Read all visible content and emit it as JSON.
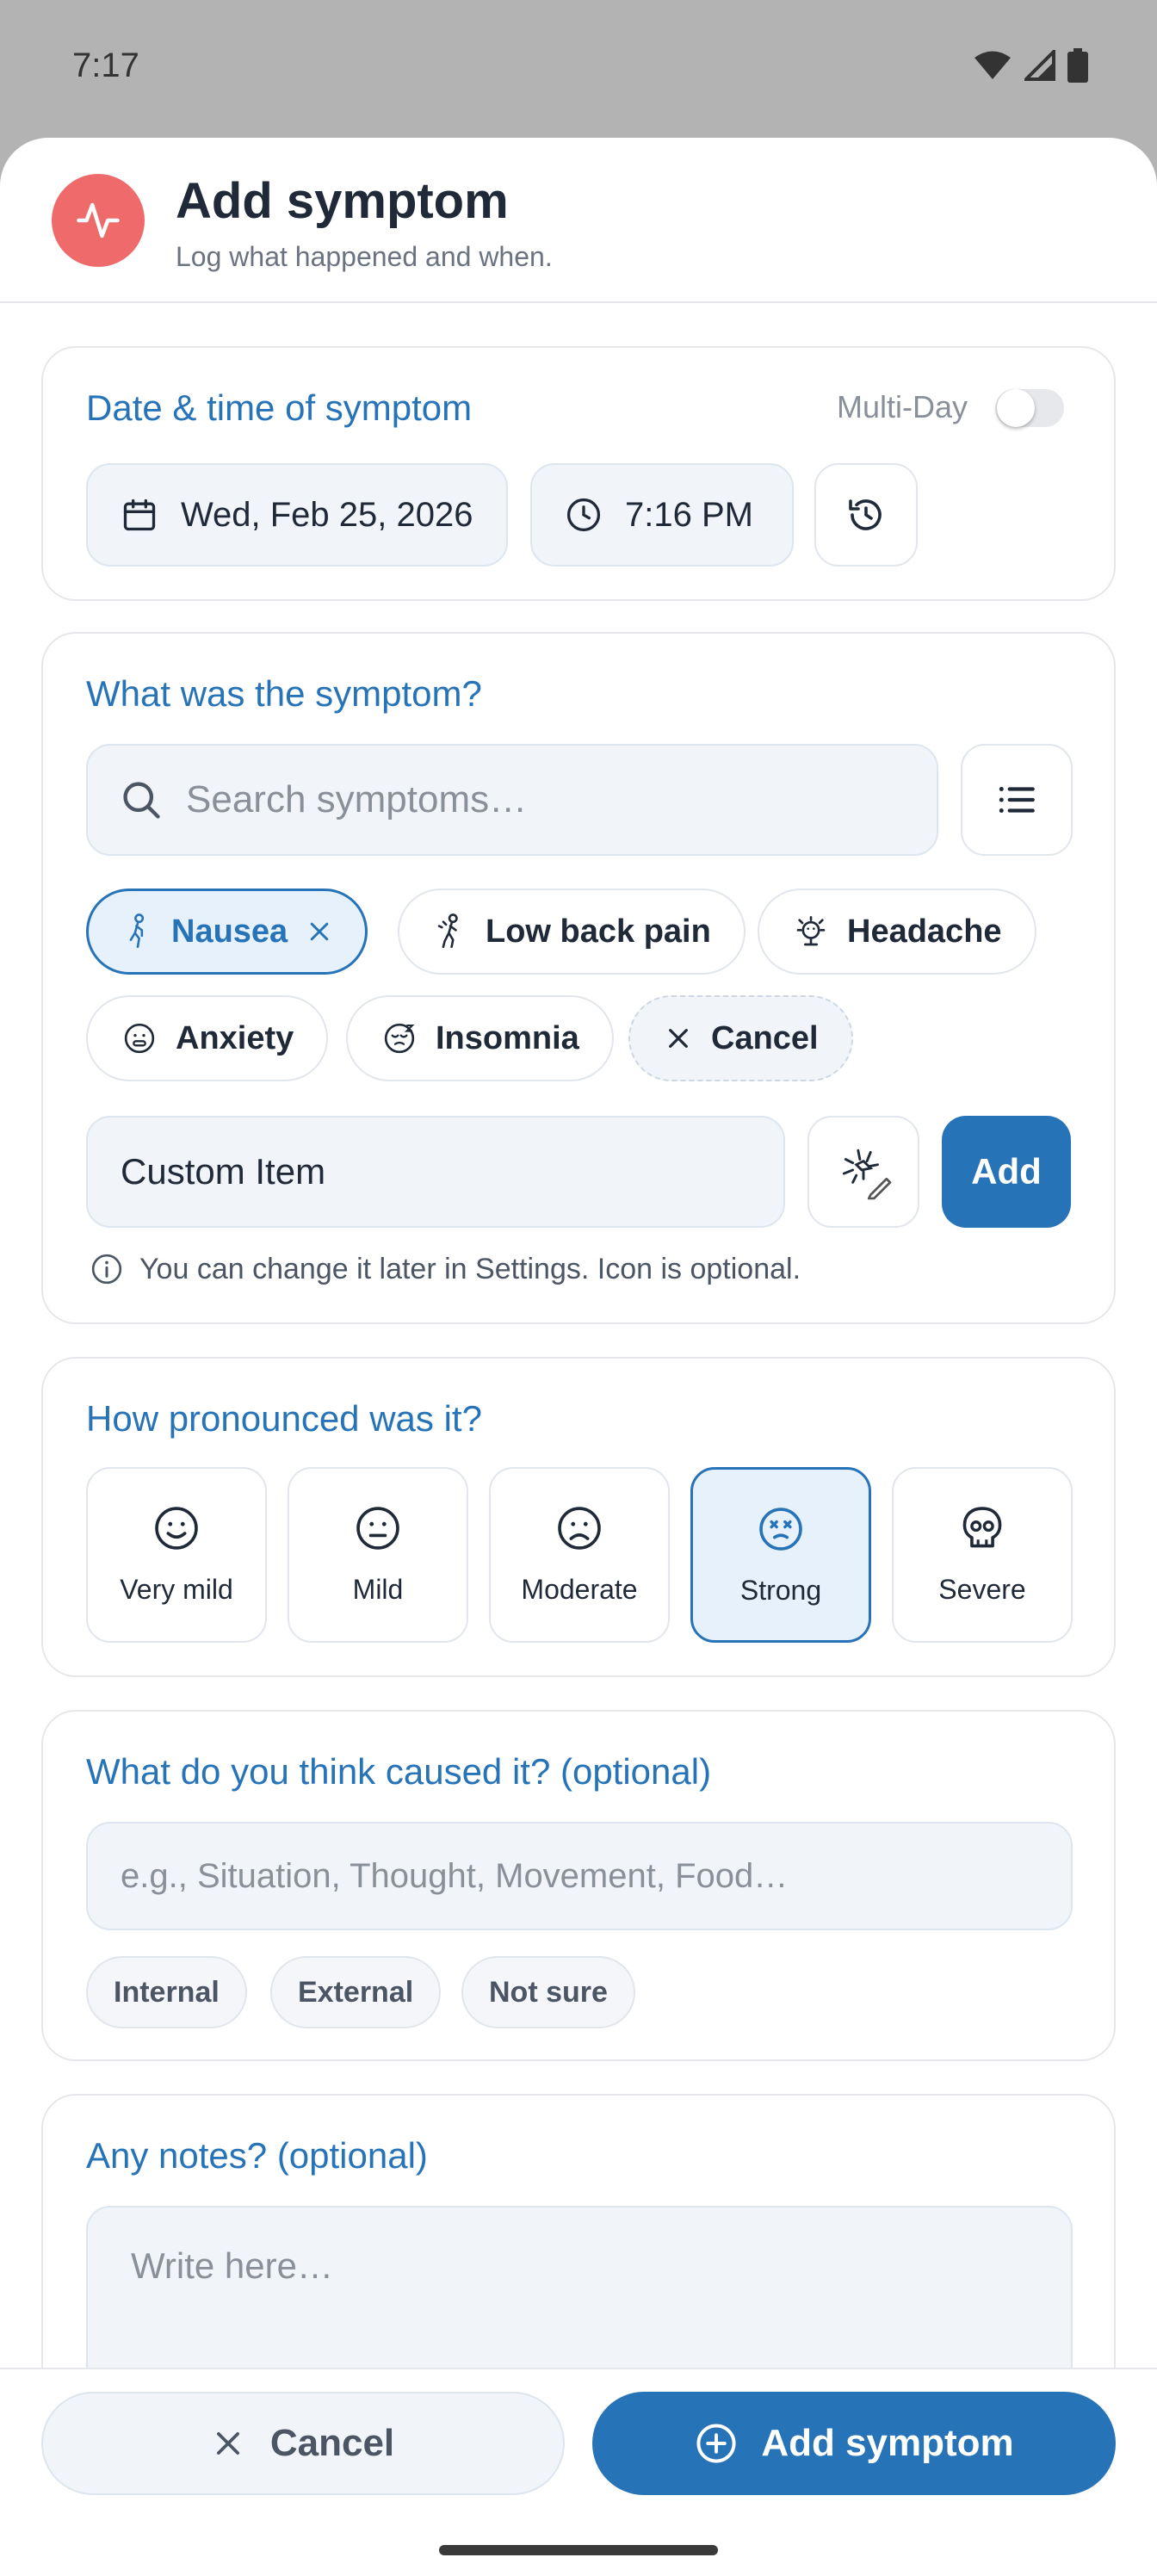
{
  "status": {
    "time": "7:17"
  },
  "header": {
    "title": "Add symptom",
    "subtitle": "Log what happened and when.",
    "icon": "activity-icon"
  },
  "date_card": {
    "title": "Date & time of symptom",
    "multi_day_label": "Multi-Day",
    "multi_day_enabled": false,
    "date": "Wed, Feb 25, 2026",
    "time": "7:16 PM"
  },
  "symptom_card": {
    "title": "What was the symptom?",
    "search_placeholder": "Search symptoms…",
    "chips": [
      {
        "label": "Nausea",
        "selected": true
      },
      {
        "label": "Low back pain",
        "selected": false
      },
      {
        "label": "Headache",
        "selected": false
      },
      {
        "label": "Anxiety",
        "selected": false
      },
      {
        "label": "Insomnia",
        "selected": false
      }
    ],
    "cancel_chip": "Cancel",
    "custom_value": "Custom Item",
    "add_label": "Add",
    "hint": "You can change it later in Settings. Icon is optional."
  },
  "severity_card": {
    "title": "How pronounced was it?",
    "levels": [
      "Very mild",
      "Mild",
      "Moderate",
      "Strong",
      "Severe"
    ],
    "selected": "Strong"
  },
  "cause_card": {
    "title": "What do you think caused it? (optional)",
    "placeholder": "e.g., Situation, Thought, Movement, Food…",
    "options": [
      "Internal",
      "External",
      "Not sure"
    ]
  },
  "notes_card": {
    "title": "Any notes? (optional)",
    "placeholder": "Write here…"
  },
  "footer": {
    "cancel_label": "Cancel",
    "submit_label": "Add symptom"
  },
  "colors": {
    "accent": "#2773b8",
    "header_icon_bg": "#ef6b6b",
    "selected_bg": "#e7f1fb"
  }
}
